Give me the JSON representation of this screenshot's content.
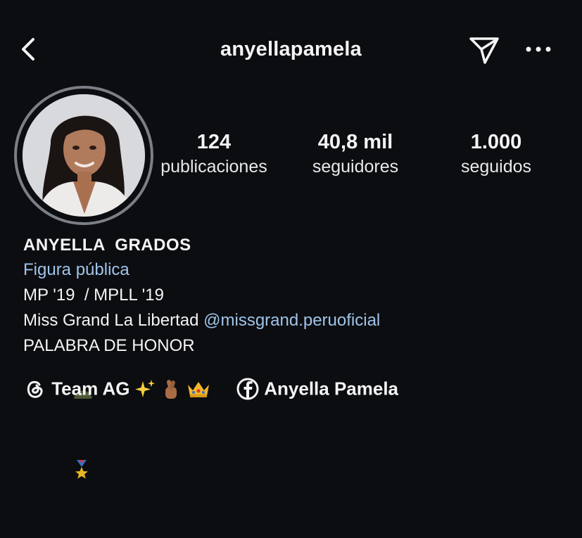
{
  "header": {
    "username": "anyellapamela",
    "icons": {
      "back": "chevron-left-icon",
      "send": "paper-plane-icon",
      "more": "more-horizontal-icon"
    }
  },
  "profile": {
    "avatar": "profile-photo",
    "stats": {
      "posts": {
        "value": "124",
        "label": "publicaciones"
      },
      "followers": {
        "value": "40,8 mil",
        "label": "seguidores"
      },
      "following": {
        "value": "1.000",
        "label": "seguidos"
      }
    }
  },
  "bio": {
    "name": "ANYELLA  GRADOS",
    "category": "Figura pública",
    "line1": "MP '19  / MPLL '19",
    "line2_text": "Miss Grand La Libertad ",
    "line2_mention": "@missgrand.peruoficial",
    "line3": "PALABRA DE HONOR"
  },
  "links": {
    "threads": {
      "label": "Team AG",
      "icon": "threads-icon",
      "emojis": [
        "sparkles",
        "crossed-fingers",
        "crown"
      ]
    },
    "facebook": {
      "label": "Anyella Pamela",
      "icon": "facebook-icon"
    }
  },
  "colors": {
    "background": "#0c0d10",
    "text": "#f4f4f5",
    "link": "#9fc4ea",
    "ring": "#7b7f86"
  }
}
